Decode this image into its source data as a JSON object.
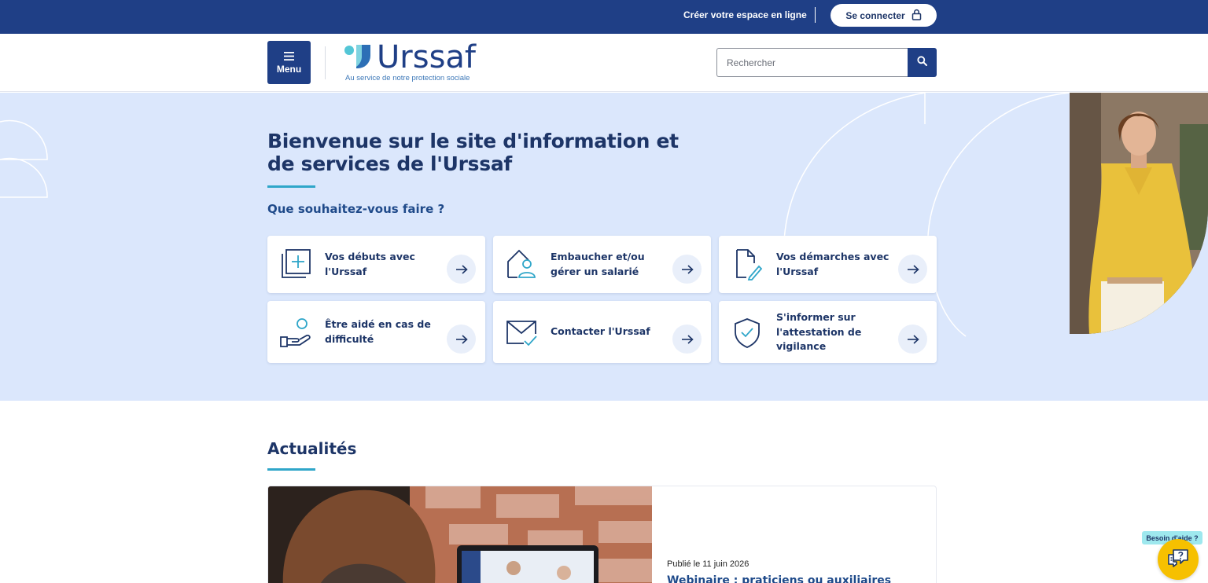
{
  "topbar": {
    "create_space_label": "Créer votre espace en ligne",
    "login_label": "Se connecter",
    "login_icon": "lock-icon",
    "background": "#1f3f86"
  },
  "header": {
    "menu_label": "Menu",
    "logo_text": "Urssaf",
    "logo_tagline": "Au service de notre protection sociale",
    "search_placeholder": "Rechercher",
    "search_icon": "search-icon"
  },
  "hero": {
    "title": "Bienvenue sur le site d'information et de services de l'Urssaf",
    "subtitle": "Que souhaitez-vous faire ?",
    "background": "#dbe7fc",
    "cards": [
      {
        "label": "Vos débuts avec l'Urssaf",
        "icon": "add-document-icon"
      },
      {
        "label": "Embaucher et/ou gérer un salarié",
        "icon": "house-person-icon"
      },
      {
        "label": "Vos démarches avec l'Urssaf",
        "icon": "document-edit-icon"
      },
      {
        "label": "Être aidé en cas de difficulté",
        "icon": "helping-hand-icon"
      },
      {
        "label": "Contacter l'Urssaf",
        "icon": "envelope-check-icon"
      },
      {
        "label": "S'informer sur l'attestation de vigilance",
        "icon": "shield-check-icon"
      }
    ]
  },
  "news": {
    "title": "Actualités",
    "items": [
      {
        "date": "Publié le 11 juin 2026",
        "headline": "Webinaire : praticiens ou auxiliaires"
      }
    ]
  },
  "help": {
    "label": "Besoin d'aide ?",
    "icon": "chat-help-icon",
    "color": "#f6c000"
  },
  "colors": {
    "primary": "#1f3f86",
    "accent": "#2fa6c9",
    "text": "#1d3567"
  }
}
